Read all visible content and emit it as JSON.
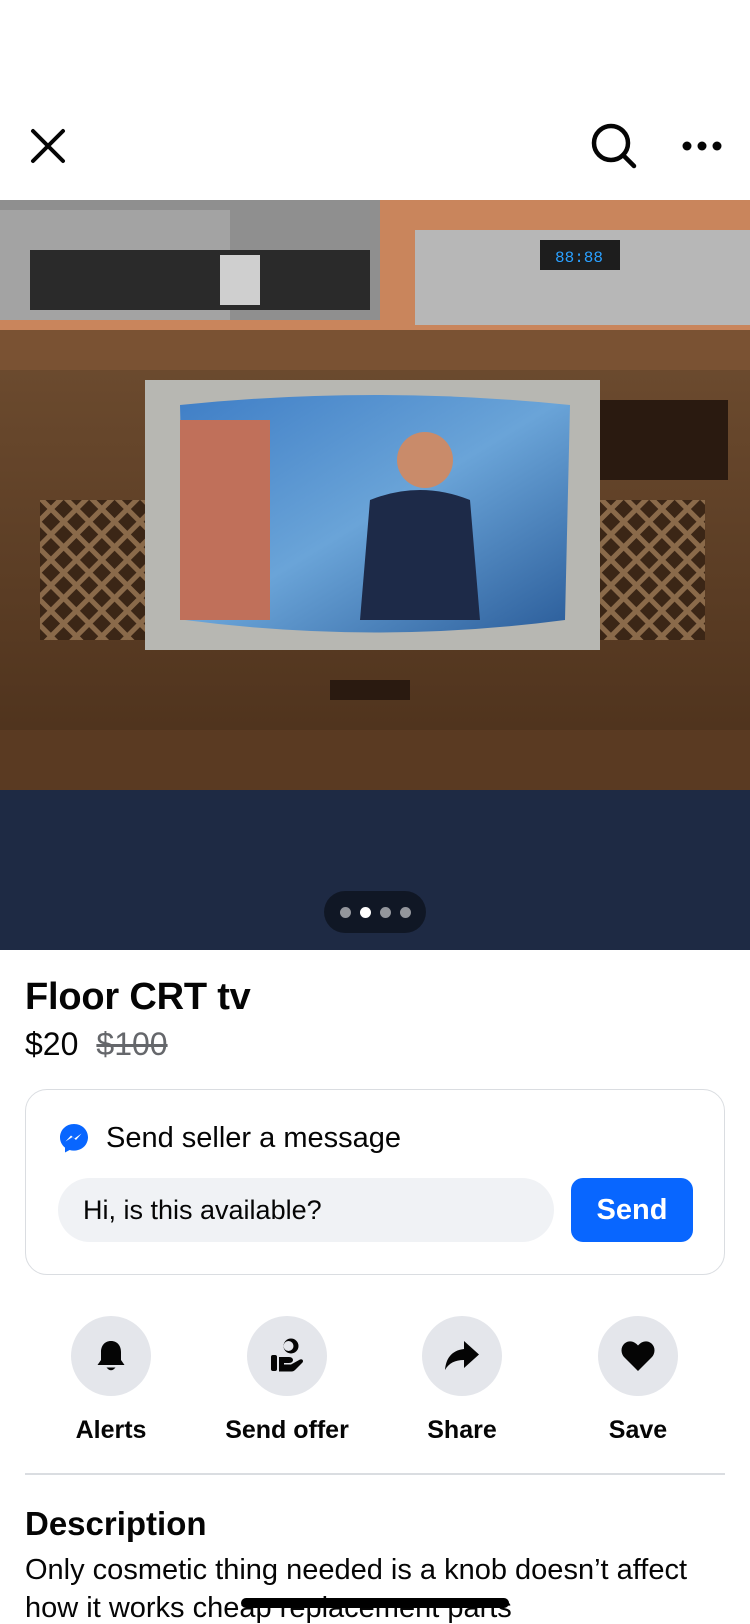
{
  "header": {
    "close_icon": "close-icon",
    "search_icon": "search-icon",
    "more_icon": "more-horizontal-icon"
  },
  "gallery": {
    "photo_count": 4,
    "active_index": 1
  },
  "listing": {
    "title": "Floor CRT tv",
    "price": "$20",
    "original_price": "$100"
  },
  "message_card": {
    "icon": "messenger-icon",
    "heading": "Send seller a message",
    "input_value": "Hi, is this available?",
    "send_label": "Send"
  },
  "actions": [
    {
      "label": "Alerts",
      "icon": "bell-icon"
    },
    {
      "label": "Send offer",
      "icon": "offer-hand-icon"
    },
    {
      "label": "Share",
      "icon": "share-arrow-icon"
    },
    {
      "label": "Save",
      "icon": "heart-icon"
    }
  ],
  "description": {
    "heading": "Description",
    "text": "Only cosmetic thing needed is a knob doesn’t affect how it works cheap replacement parts"
  },
  "colors": {
    "accent": "#0866ff",
    "chip_bg": "#e4e6eb",
    "input_bg": "#f0f2f5",
    "muted_text": "#65676b"
  }
}
